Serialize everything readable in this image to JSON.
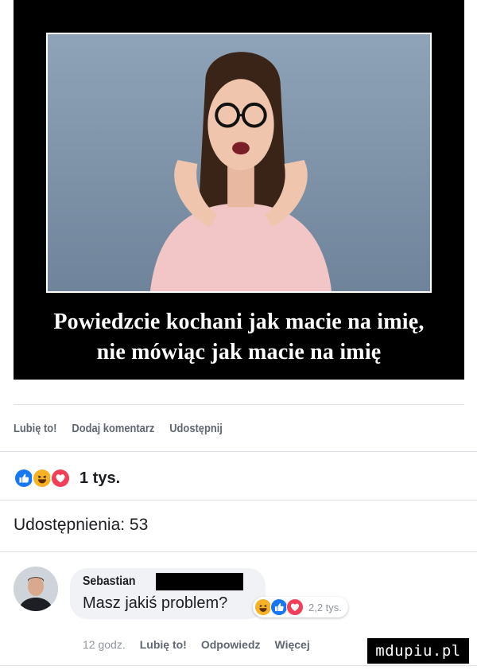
{
  "poster": {
    "caption_line1": "Powiedzcie kochani jak macie na imię,",
    "caption_line2": "nie mówiąc jak macie na imię"
  },
  "post_actions": {
    "like": "Lubię to!",
    "comment": "Dodaj komentarz",
    "share": "Udostępnij"
  },
  "reactions": {
    "icons": [
      "like-icon",
      "haha-icon",
      "love-icon"
    ],
    "count": "1 tys."
  },
  "shares": "Udostępnienia: 53",
  "comment": {
    "author": "Sebastian",
    "text": "Masz jakiś problem?",
    "reaction_icons": [
      "haha-icon",
      "like-icon",
      "love-icon"
    ],
    "reaction_count": "2,2 tys.",
    "time": "12 godz.",
    "like": "Lubię to!",
    "reply": "Odpowiedz",
    "more": "Więcej"
  },
  "watermark": "mdupiu.pl",
  "colors": {
    "like_blue": "#1877f2",
    "love_red": "#f33e58",
    "haha_yellow": "#f7b125",
    "muted_text": "#606770"
  }
}
